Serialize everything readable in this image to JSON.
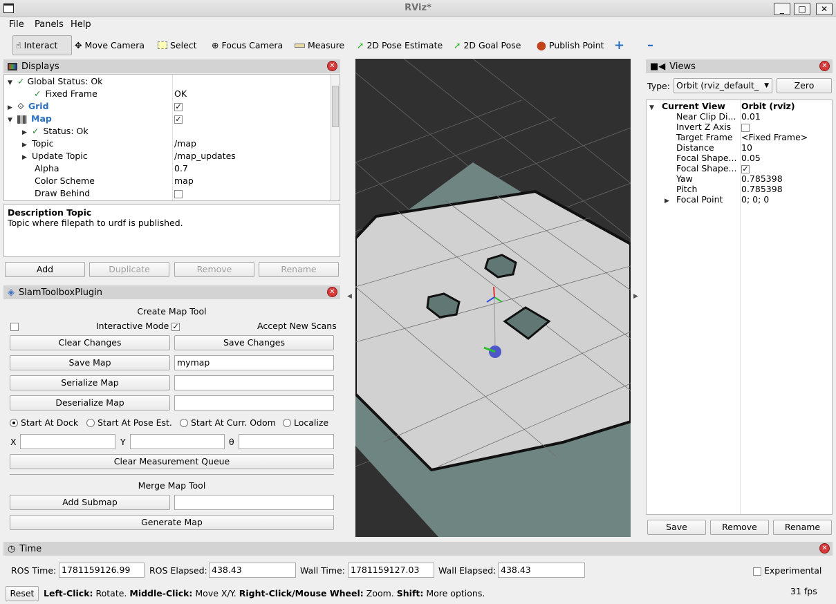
{
  "window": {
    "title": "RViz*",
    "minimize": "_",
    "maximize": "□",
    "close": "✕"
  },
  "menu": [
    "File",
    "Panels",
    "Help"
  ],
  "toolbar": [
    "Interact",
    "Move Camera",
    "Select",
    "Focus Camera",
    "Measure",
    "2D Pose Estimate",
    "2D Goal Pose",
    "Publish Point"
  ],
  "displays": {
    "title": "Displays",
    "rows": [
      {
        "label": "Global Status: Ok",
        "value": ""
      },
      {
        "label": "Fixed Frame",
        "value": "OK"
      },
      {
        "label": "Grid",
        "value": "✓"
      },
      {
        "label": "Map",
        "value": "✓"
      },
      {
        "label": "Status: Ok",
        "value": ""
      },
      {
        "label": "Topic",
        "value": "/map"
      },
      {
        "label": "Update Topic",
        "value": "/map_updates"
      },
      {
        "label": "Alpha",
        "value": "0.7"
      },
      {
        "label": "Color Scheme",
        "value": "map"
      },
      {
        "label": "Draw Behind",
        "value": ""
      }
    ],
    "desc_title": "Description Topic",
    "desc_text": "Topic where filepath to urdf is published.",
    "buttons": [
      "Add",
      "Duplicate",
      "Remove",
      "Rename"
    ]
  },
  "slam": {
    "title": "SlamToolboxPlugin",
    "create_title": "Create Map Tool",
    "interactive_mode": "Interactive Mode",
    "accept_scans": "Accept New Scans",
    "clear_changes": "Clear Changes",
    "save_changes": "Save Changes",
    "save_map": "Save Map",
    "map_name": "mymap",
    "serialize": "Serialize Map",
    "deserialize": "Deserialize Map",
    "radios": [
      "Start At Dock",
      "Start At Pose Est.",
      "Start At Curr. Odom",
      "Localize"
    ],
    "x": "X",
    "y": "Y",
    "theta": "θ",
    "clear_queue": "Clear Measurement Queue",
    "merge_title": "Merge Map Tool",
    "add_submap": "Add Submap",
    "generate": "Generate Map"
  },
  "views": {
    "title": "Views",
    "type_label": "Type:",
    "type_value": "Orbit (rviz_default_",
    "zero": "Zero",
    "current": "Current View",
    "current_value": "Orbit (rviz)",
    "rows": [
      {
        "label": "Near Clip Di...",
        "value": "0.01"
      },
      {
        "label": "Invert Z Axis",
        "value": ""
      },
      {
        "label": "Target Frame",
        "value": "<Fixed Frame>"
      },
      {
        "label": "Distance",
        "value": "10"
      },
      {
        "label": "Focal Shape...",
        "value": "0.05"
      },
      {
        "label": "Focal Shape...",
        "value": "✓"
      },
      {
        "label": "Yaw",
        "value": "0.785398"
      },
      {
        "label": "Pitch",
        "value": "0.785398"
      },
      {
        "label": "Focal Point",
        "value": "0; 0; 0"
      }
    ],
    "buttons": [
      "Save",
      "Remove",
      "Rename"
    ]
  },
  "time": {
    "title": "Time",
    "ros_time_label": "ROS Time:",
    "ros_time": "1781159126.99",
    "ros_elapsed_label": "ROS Elapsed:",
    "ros_elapsed": "438.43",
    "wall_time_label": "Wall Time:",
    "wall_time": "1781159127.03",
    "wall_elapsed_label": "Wall Elapsed:",
    "wall_elapsed": "438.43",
    "experimental": "Experimental"
  },
  "status": {
    "reset": "Reset",
    "left": "Left-Click:",
    "left_t": " Rotate. ",
    "middle": "Middle-Click:",
    "middle_t": " Move X/Y. ",
    "right": "Right-Click/Mouse Wheel:",
    "right_t": " Zoom. ",
    "shift": "Shift:",
    "shift_t": " More options.",
    "fps": "31 fps"
  }
}
